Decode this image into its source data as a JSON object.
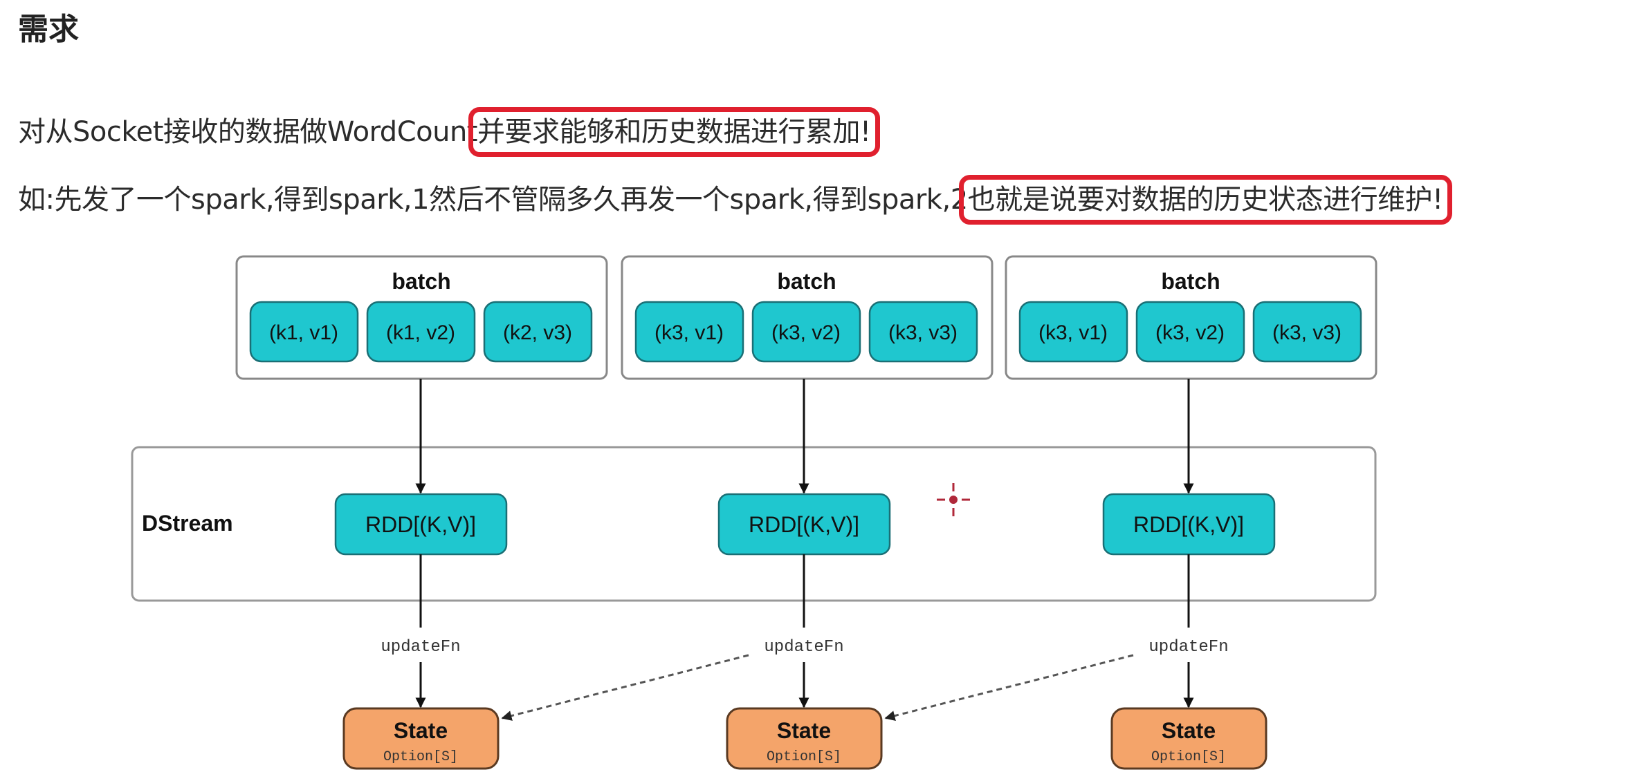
{
  "heading": "需求",
  "paragraph1": {
    "prefix": "对从Socket接收的数据做WordCount",
    "highlight": "并要求能够和历史数据进行累加!"
  },
  "paragraph2": {
    "prefix": "如:先发了一个spark,得到spark,1然后不管隔多久再发一个spark,得到spark,2",
    "highlight": "也就是说要对数据的历史状态进行维护!"
  },
  "diagram": {
    "batches": [
      {
        "label": "batch",
        "items": [
          "(k1, v1)",
          "(k1, v2)",
          "(k2, v3)"
        ]
      },
      {
        "label": "batch",
        "items": [
          "(k3, v1)",
          "(k3, v2)",
          "(k3, v3)"
        ]
      },
      {
        "label": "batch",
        "items": [
          "(k3, v1)",
          "(k3, v2)",
          "(k3, v3)"
        ]
      }
    ],
    "dstream_label": "DStream",
    "rdd_label": "RDD[(K,V)]",
    "update_fn": "updateFn",
    "state_title": "State",
    "state_type": "Option[S]",
    "colors": {
      "teal": "#1fc7cf",
      "orange": "#f4a46a",
      "highlight": "#e0202e"
    }
  }
}
